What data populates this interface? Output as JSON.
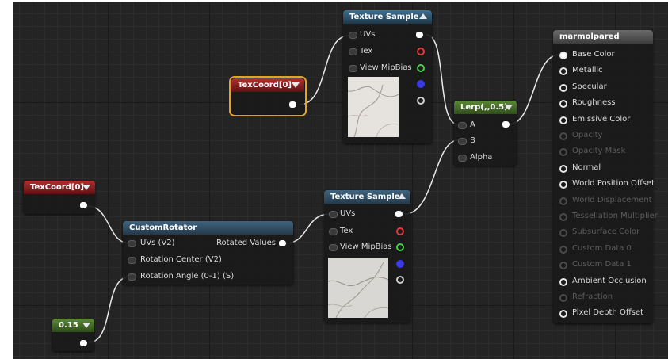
{
  "colors": {
    "graph_bg": "#242424",
    "wire": "#ffffff",
    "selected_outline": "#e8a317",
    "pin_red": "#e03a3a",
    "pin_green": "#46d04a",
    "pin_blue": "#3a3ae8",
    "pin_gray": "#d0d0d0"
  },
  "nodes": {
    "texture_sample_top": {
      "title": "Texture Sample",
      "header_icon": "collapse-up-icon",
      "inputs": [
        "UVs",
        "Tex",
        "View MipBias"
      ]
    },
    "texcoord_top": {
      "title": "TexCoord[0]",
      "header_icon": "dropdown-arrow-icon"
    },
    "lerp": {
      "title": "Lerp(,,0.5)",
      "header_icon": "dropdown-arrow-icon",
      "inputs": [
        "A",
        "B",
        "Alpha"
      ]
    },
    "material": {
      "title": "marmolpared",
      "inputs": [
        {
          "label": "Base Color",
          "enabled": true
        },
        {
          "label": "Metallic",
          "enabled": true
        },
        {
          "label": "Specular",
          "enabled": true
        },
        {
          "label": "Roughness",
          "enabled": true
        },
        {
          "label": "Emissive Color",
          "enabled": true
        },
        {
          "label": "Opacity",
          "enabled": false
        },
        {
          "label": "Opacity Mask",
          "enabled": false
        },
        {
          "label": "Normal",
          "enabled": true
        },
        {
          "label": "World Position Offset",
          "enabled": true
        },
        {
          "label": "World Displacement",
          "enabled": false
        },
        {
          "label": "Tessellation Multiplier",
          "enabled": false
        },
        {
          "label": "Subsurface Color",
          "enabled": false
        },
        {
          "label": "Custom Data 0",
          "enabled": false
        },
        {
          "label": "Custom Data 1",
          "enabled": false
        },
        {
          "label": "Ambient Occlusion",
          "enabled": true
        },
        {
          "label": "Refraction",
          "enabled": false
        },
        {
          "label": "Pixel Depth Offset",
          "enabled": true
        }
      ]
    },
    "texcoord_bottom": {
      "title": "TexCoord[0]",
      "header_icon": "dropdown-arrow-icon"
    },
    "texture_sample_bottom": {
      "title": "Texture Sample",
      "header_icon": "collapse-up-icon",
      "inputs": [
        "UVs",
        "Tex",
        "View MipBias"
      ]
    },
    "custom_rotator": {
      "title": "CustomRotator",
      "inputs": [
        "UVs (V2)",
        "Rotation Center (V2)",
        "Rotation Angle (0-1) (S)"
      ],
      "output": "Rotated Values"
    },
    "constant": {
      "title": "0.15",
      "header_icon": "dropdown-arrow-icon"
    }
  }
}
